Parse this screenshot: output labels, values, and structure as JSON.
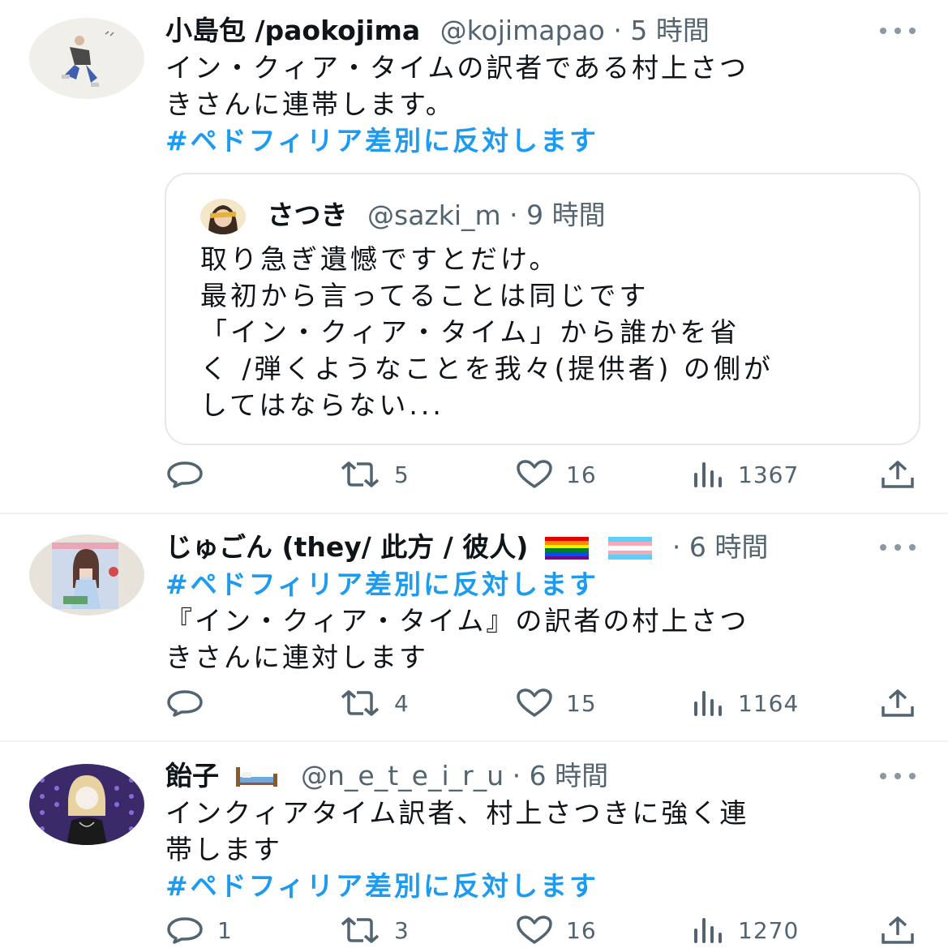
{
  "tweets": [
    {
      "display_name": "小島包 /paokojima",
      "handle": "@kojimapao",
      "time": "5 時間",
      "lines": [
        "イン・クィア・タイムの訳者である村上さつ",
        "きさんに連帯します。"
      ],
      "hashtag": "#ペドフィリア差別に反対します",
      "quote": {
        "display_name": "さつき",
        "handle": "@sazki_m",
        "time": "9 時間",
        "lines": [
          "取り急ぎ遺憾ですとだけ。",
          "最初から言ってることは同じです",
          "「イン・クィア・タイム」から誰かを省",
          "く /弾くようなことを我々(提供者) の側が",
          "してはならない..."
        ]
      },
      "stats": {
        "replies": "",
        "retweets": "5",
        "likes": "16",
        "views": "1367"
      }
    },
    {
      "display_name": "じゅごん (they/ 此方 / 彼人)",
      "handle": "",
      "time": "6 時間",
      "hashtag": "#ペドフィリア差別に反対します",
      "lines": [
        "『イン・クィア・タイム』の訳者の村上さつ",
        "きさんに連対します"
      ],
      "stats": {
        "replies": "",
        "retweets": "4",
        "likes": "15",
        "views": "1164"
      }
    },
    {
      "display_name": "飴子",
      "handle": "@n_e_t_e_i_r_u",
      "time": "6 時間",
      "lines": [
        "インクィアタイム訳者、村上さつきに強く連",
        "帯します"
      ],
      "hashtag": "#ペドフィリア差別に反対します",
      "stats": {
        "replies": "1",
        "retweets": "3",
        "likes": "16",
        "views": "1270"
      }
    }
  ],
  "colors": {
    "hashtag": "#1d9bf0",
    "meta": "#536471",
    "name": "#0f1419",
    "separator": "#eff3f4"
  },
  "icons": [
    "reply-icon",
    "retweet-icon",
    "like-icon",
    "views-icon",
    "share-icon",
    "more-icon",
    "rainbow-flag-emoji",
    "trans-flag-emoji",
    "bed-emoji"
  ]
}
